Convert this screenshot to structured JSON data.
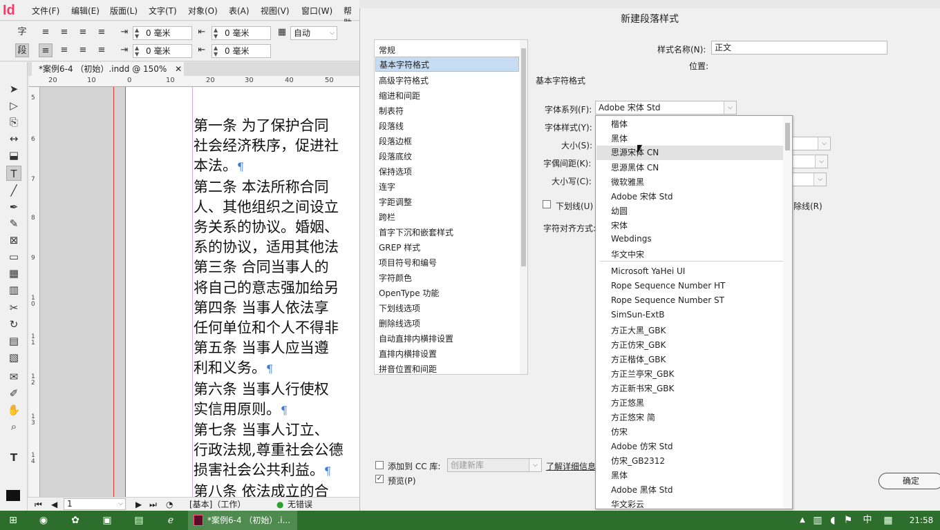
{
  "app": {
    "logo": "Id",
    "menus": [
      "文件(F)",
      "编辑(E)",
      "版面(L)",
      "文字(T)",
      "对象(O)",
      "表(A)",
      "视图(V)",
      "窗口(W)",
      "帮助"
    ]
  },
  "control_panel": {
    "char_mode": "字",
    "para_mode": "段",
    "left_indent": "0 毫米",
    "right_indent": "0 毫米",
    "first_indent": "0 毫米",
    "last_indent": "0 毫米",
    "leading": "自动"
  },
  "document": {
    "tab_title": "*案例6-4 （初始）.indd @ 150%",
    "close_glyph": "✕",
    "h_ruler": [
      "20",
      "10",
      "0",
      "10",
      "20",
      "30",
      "40",
      "50"
    ],
    "v_ruler": [
      "5",
      "6",
      "7",
      "8",
      "9",
      "1 0",
      "1 1",
      "1 2",
      "1 3",
      "1 4"
    ],
    "lines": [
      {
        "t": "第一条 为了保护合同",
        "p": false
      },
      {
        "t": "社会经济秩序，促进社",
        "p": false
      },
      {
        "t": "本法。",
        "p": true
      },
      {
        "t": "第二条 本法所称合同",
        "p": false
      },
      {
        "t": "人、其他组织之间设立",
        "p": false
      },
      {
        "t": "务关系的协议。婚姻、",
        "p": false
      },
      {
        "t": "系的协议，适用其他法",
        "p": false
      },
      {
        "t": "第三条 合同当事人的",
        "p": false
      },
      {
        "t": "将自己的意志强加给另",
        "p": false
      },
      {
        "t": "第四条 当事人依法享",
        "p": false
      },
      {
        "t": "任何单位和个人不得非",
        "p": false
      },
      {
        "t": "第五条 当事人应当遵",
        "p": false
      },
      {
        "t": "利和义务。",
        "p": true
      },
      {
        "t": "第六条 当事人行使权",
        "p": false
      },
      {
        "t": "实信用原则。",
        "p": true
      },
      {
        "t": "第七条 当事人订立、",
        "p": false
      },
      {
        "t": "行政法规,尊重社会公德",
        "p": false
      },
      {
        "t": "损害社会公共利益。",
        "p": true
      },
      {
        "t": "第八条 依法成立的合",
        "p": false
      }
    ],
    "pilcrow": "¶"
  },
  "status": {
    "page": "1",
    "profile": "[基本]（工作）",
    "preflight": "无错误"
  },
  "dialog": {
    "title": "新建段落样式",
    "categories": [
      "常规",
      "基本字符格式",
      "高级字符格式",
      "缩进和间距",
      "制表符",
      "段落线",
      "段落边框",
      "段落底纹",
      "保持选项",
      "连字",
      "字距调整",
      "跨栏",
      "首字下沉和嵌套样式",
      "GREP 样式",
      "项目符号和编号",
      "字符颜色",
      "OpenType 功能",
      "下划线选项",
      "删除线选项",
      "自动直排内横排设置",
      "直排内横排设置",
      "拼音位置和间距"
    ],
    "selected_index": 1,
    "style_name_label": "样式名称(N):",
    "style_name_value": "正文",
    "location_label": "位置:",
    "section_title": "基本字符格式",
    "font_family_label": "字体系列(F):",
    "font_family_value": "Adobe 宋体 Std",
    "font_style_label": "字体样式(Y):",
    "size_label": "大小(S):",
    "tracking_label": "字偶间距(K):",
    "case_label": "大小写(C):",
    "underline_label": "下划线(U)",
    "strikethrough_label": "除线(R)",
    "align_label": "字符对齐方式:",
    "add_to_cc_label": "添加到 CC 库:",
    "cc_placeholder": "创建新库",
    "learn_more": "了解详细信息...",
    "preview_label": "预览(P)",
    "ok_label": "确定",
    "font_group1": [
      "楷体",
      "黑体",
      "思源宋体 CN",
      "思源黑体 CN",
      "微软雅黑",
      "Adobe 宋体 Std",
      "幼圆",
      "宋体",
      "Webdings",
      "华文中宋"
    ],
    "font_group2": [
      "Microsoft YaHei UI",
      "Rope Sequence Number HT",
      "Rope Sequence Number ST",
      "SimSun-ExtB",
      "方正大黑_GBK",
      "方正仿宋_GBK",
      "方正楷体_GBK",
      "方正兰亭宋_GBK",
      "方正新书宋_GBK",
      "方正悠黑",
      "方正悠宋 简",
      "仿宋",
      "Adobe 仿宋 Std",
      "仿宋_GB2312",
      "黑体",
      "Adobe 黑体 Std",
      "华文彩云"
    ],
    "highlight_index": 2
  },
  "taskbar": {
    "active_title": "*案例6-4 （初始）.i...",
    "ime": "中",
    "clock": "21:58"
  }
}
